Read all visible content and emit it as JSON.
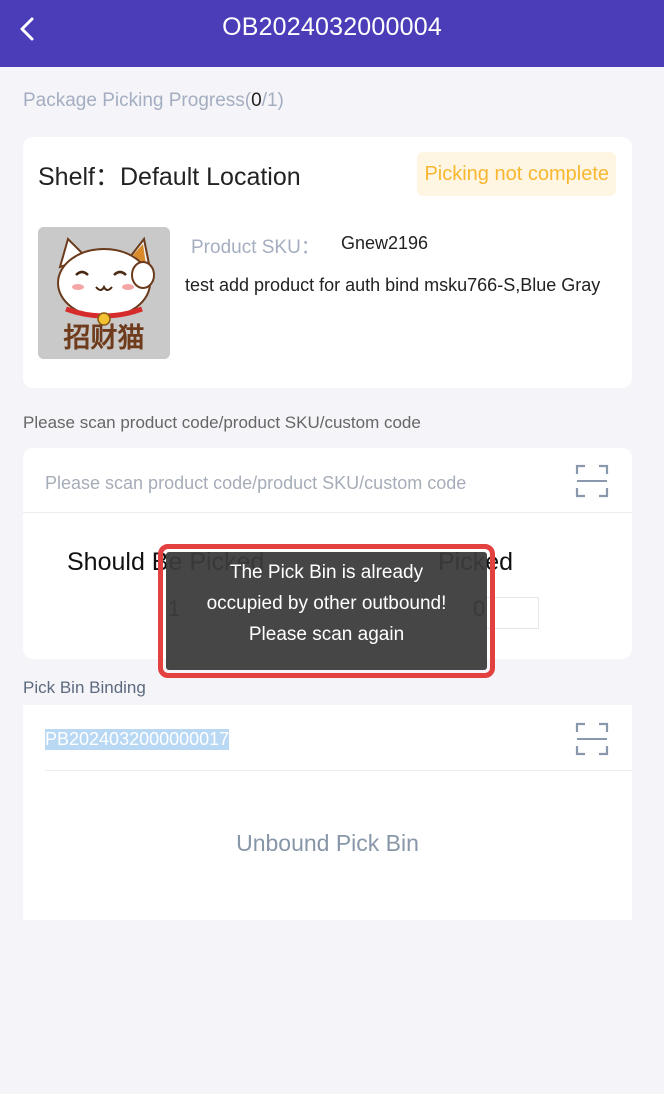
{
  "header": {
    "title": "OB2024032000004",
    "back_icon": "chevron-left-icon",
    "background": "#4b3db8"
  },
  "progress": {
    "label": "Package Picking Progress(",
    "current": "0",
    "separator": "/",
    "total": "1",
    "close": ")"
  },
  "shelf": {
    "label": "Shelf：Default Location",
    "status": "Picking not complete",
    "status_color": "#f7b731",
    "product_image": "lucky-cat-product-image",
    "product_image_text": "招财猫",
    "sku_label": "Product SKU：",
    "sku_value": "Gnew2196",
    "product_name": "test add product for auth bind msku766-S,Blue Gray"
  },
  "scan": {
    "caption": "Please scan product code/product SKU/custom code",
    "placeholder": "Please scan product code/product SKU/custom code",
    "value": "",
    "icon": "scan-icon",
    "should_label": "Should Be Picked",
    "should_value": "1",
    "picked_label": "Picked",
    "picked_value": "0"
  },
  "bin": {
    "caption": "Pick Bin Binding",
    "value": "PB2024032000000017",
    "icon": "scan-icon",
    "unbind_label": "Unbound Pick Bin"
  },
  "toast": {
    "line1": "The Pick Bin is already",
    "line2": "occupied by other outbound!",
    "line3": "Please scan again",
    "highlight_color": "#e34040"
  }
}
